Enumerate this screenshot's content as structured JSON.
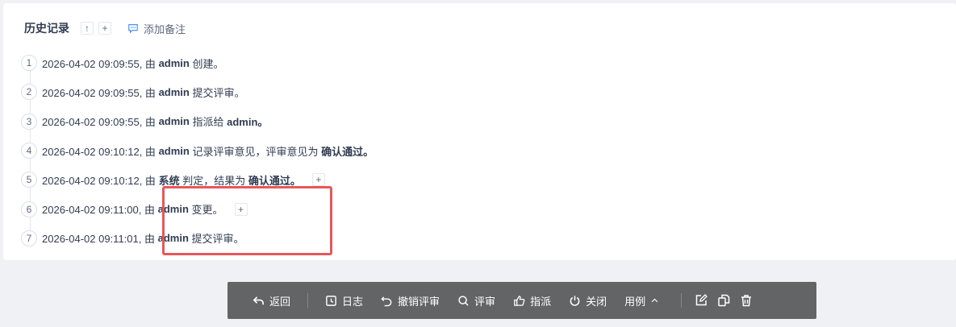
{
  "history": {
    "title": "历史记录",
    "up_label": "↑",
    "add_label": "+",
    "add_note_label": "添加备注",
    "items": [
      {
        "num": "1",
        "time": "2026-04-02 09:09:55, 由",
        "actor": "admin",
        "action": "创建。",
        "extra": "",
        "has_plus": false
      },
      {
        "num": "2",
        "time": "2026-04-02 09:09:55, 由",
        "actor": "admin",
        "action": "提交评审。",
        "extra": "",
        "has_plus": false
      },
      {
        "num": "3",
        "time": "2026-04-02 09:09:55, 由",
        "actor": "admin",
        "action": "指派给",
        "extra": "admin。",
        "has_plus": false
      },
      {
        "num": "4",
        "time": "2026-04-02 09:10:12, 由",
        "actor": "admin",
        "action": "记录评审意见，评审意见为",
        "extra": "确认通过。",
        "has_plus": false
      },
      {
        "num": "5",
        "time": "2026-04-02 09:10:12, 由",
        "actor": "系统",
        "action": "判定，结果为",
        "extra": "确认通过。",
        "has_plus": true
      },
      {
        "num": "6",
        "time": "2026-04-02 09:11:00, 由",
        "actor": "admin",
        "action": "变更。",
        "extra": "",
        "has_plus": true
      },
      {
        "num": "7",
        "time": "2026-04-02 09:11:01, 由",
        "actor": "admin",
        "action": "提交评审。",
        "extra": "",
        "has_plus": false
      }
    ]
  },
  "toolbar": {
    "back": "返回",
    "log": "日志",
    "undo_review": "撤销评审",
    "review": "评审",
    "assign": "指派",
    "close": "关闭",
    "use_case": "用例",
    "plus": "+"
  },
  "colors": {
    "toolbar_bg": "#636466",
    "highlight_border": "#e8575a",
    "page_bg": "#f0f1f4"
  }
}
